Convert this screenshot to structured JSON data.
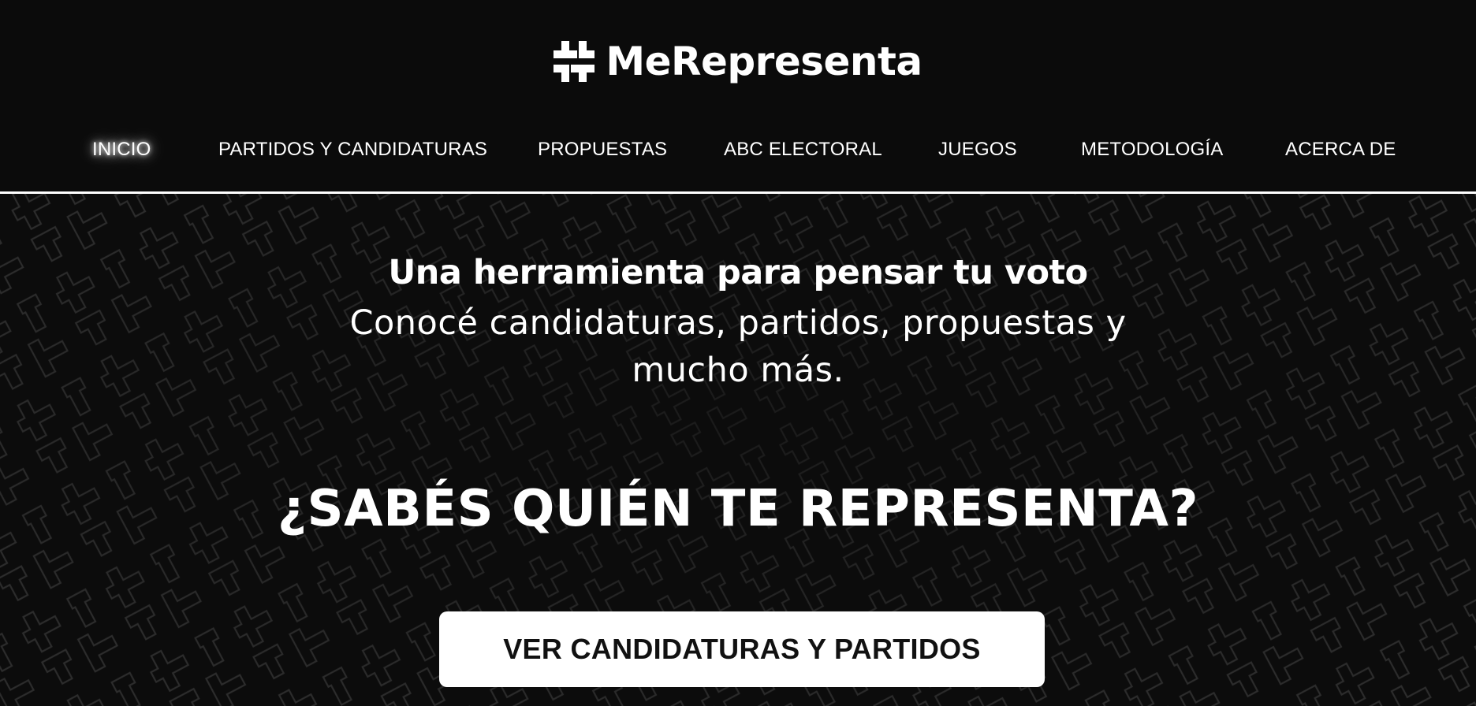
{
  "brand": {
    "name": "MeRepresenta",
    "logo_icon": "hashtag-blocks-logo"
  },
  "nav": {
    "items": [
      {
        "label": "INICIO",
        "active": true
      },
      {
        "label": "PARTIDOS Y CANDIDATURAS",
        "active": false
      },
      {
        "label": "PROPUESTAS",
        "active": false
      },
      {
        "label": "ABC ELECTORAL",
        "active": false
      },
      {
        "label": "JUEGOS",
        "active": false
      },
      {
        "label": "METODOLOGÍA",
        "active": false
      },
      {
        "label": "ACERCA DE",
        "active": false
      }
    ]
  },
  "hero": {
    "tagline": "Una herramienta para pensar tu voto",
    "subtitle": "Conocé candidaturas, partidos, propuestas y mucho más.",
    "question": "¿SABÉS QUIÉN TE REPRESENTA?",
    "cta_label": "VER CANDIDATURAS Y PARTIDOS"
  },
  "colors": {
    "background": "#0b0b0b",
    "text": "#ffffff",
    "button_bg": "#ffffff",
    "button_text": "#111111",
    "pattern_stroke": "#2a2a2a"
  }
}
